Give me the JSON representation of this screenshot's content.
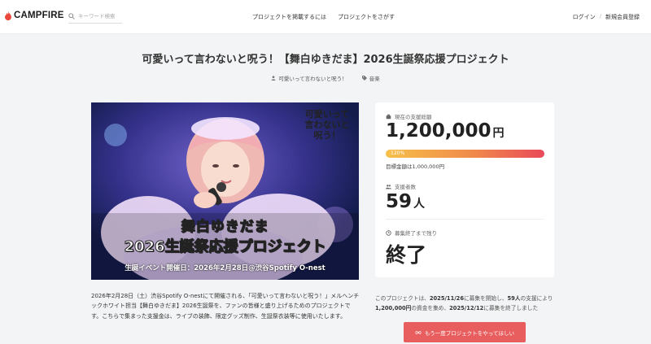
{
  "header": {
    "logo_text": "CAMPFIRE",
    "search_placeholder": "キーワード検索",
    "nav": {
      "start": "プロジェクトを掲載するには",
      "find": "プロジェクトをさがす"
    },
    "login": "ログイン",
    "separator": "/",
    "signup": "新規会員登録"
  },
  "project": {
    "title": "可愛いって言わないと呪う！【舞白ゆきだま】2026生誕祭応援プロジェクト",
    "owner": "可愛いって言わないと呪う！",
    "category": "音楽"
  },
  "hero": {
    "corner_logo": "可愛いって言わないと呪う！",
    "line1": "舞白ゆきだま",
    "line2": "2026生誕祭応援プロジェクト",
    "line3": "生誕イベント開催日：2026年2月28日@渋谷Spotify O-nest",
    "colors": {
      "bg": "#1f2a60",
      "stage": "#3b2a86",
      "hair": "#f3b9b0"
    }
  },
  "description": "2026年2月28日（土）渋谷Spotify O-nestにて開催される、「可愛いって言わないと呪う！」メルヘンチックホワイト担当【舞白ゆきだま】2026生誕祭を、ファンの皆様と盛り上げるためのプロジェクトです。こちらで集まった支援金は、ライブの装飾、限定グッズ制作、生誕祭衣装等に使用いたします。",
  "stats": {
    "total_label": "現在の支援総額",
    "total_value": "1,200,000",
    "total_unit": "円",
    "progress_label": "120%",
    "progress_percent": 120,
    "goal": "目標金額は1,000,000円",
    "supporters_label": "支援者数",
    "supporters_value": "59",
    "supporters_unit": "人",
    "remaining_label": "募集終了まで残り",
    "remaining_value": "終了",
    "accent_color": "#e85d5d"
  },
  "summary": {
    "p1": "このプロジェクトは、",
    "start_date": "2025/11/26",
    "p2": "に募集を開始し、",
    "supporters": "59人",
    "p3": "の支援により",
    "amount": "1,200,000円",
    "p4": "の資金を集め、",
    "end_date": "2025/12/12",
    "p5": "に募集を終了しました"
  },
  "cta": {
    "label": "もう一度プロジェクトをやってほしい"
  }
}
